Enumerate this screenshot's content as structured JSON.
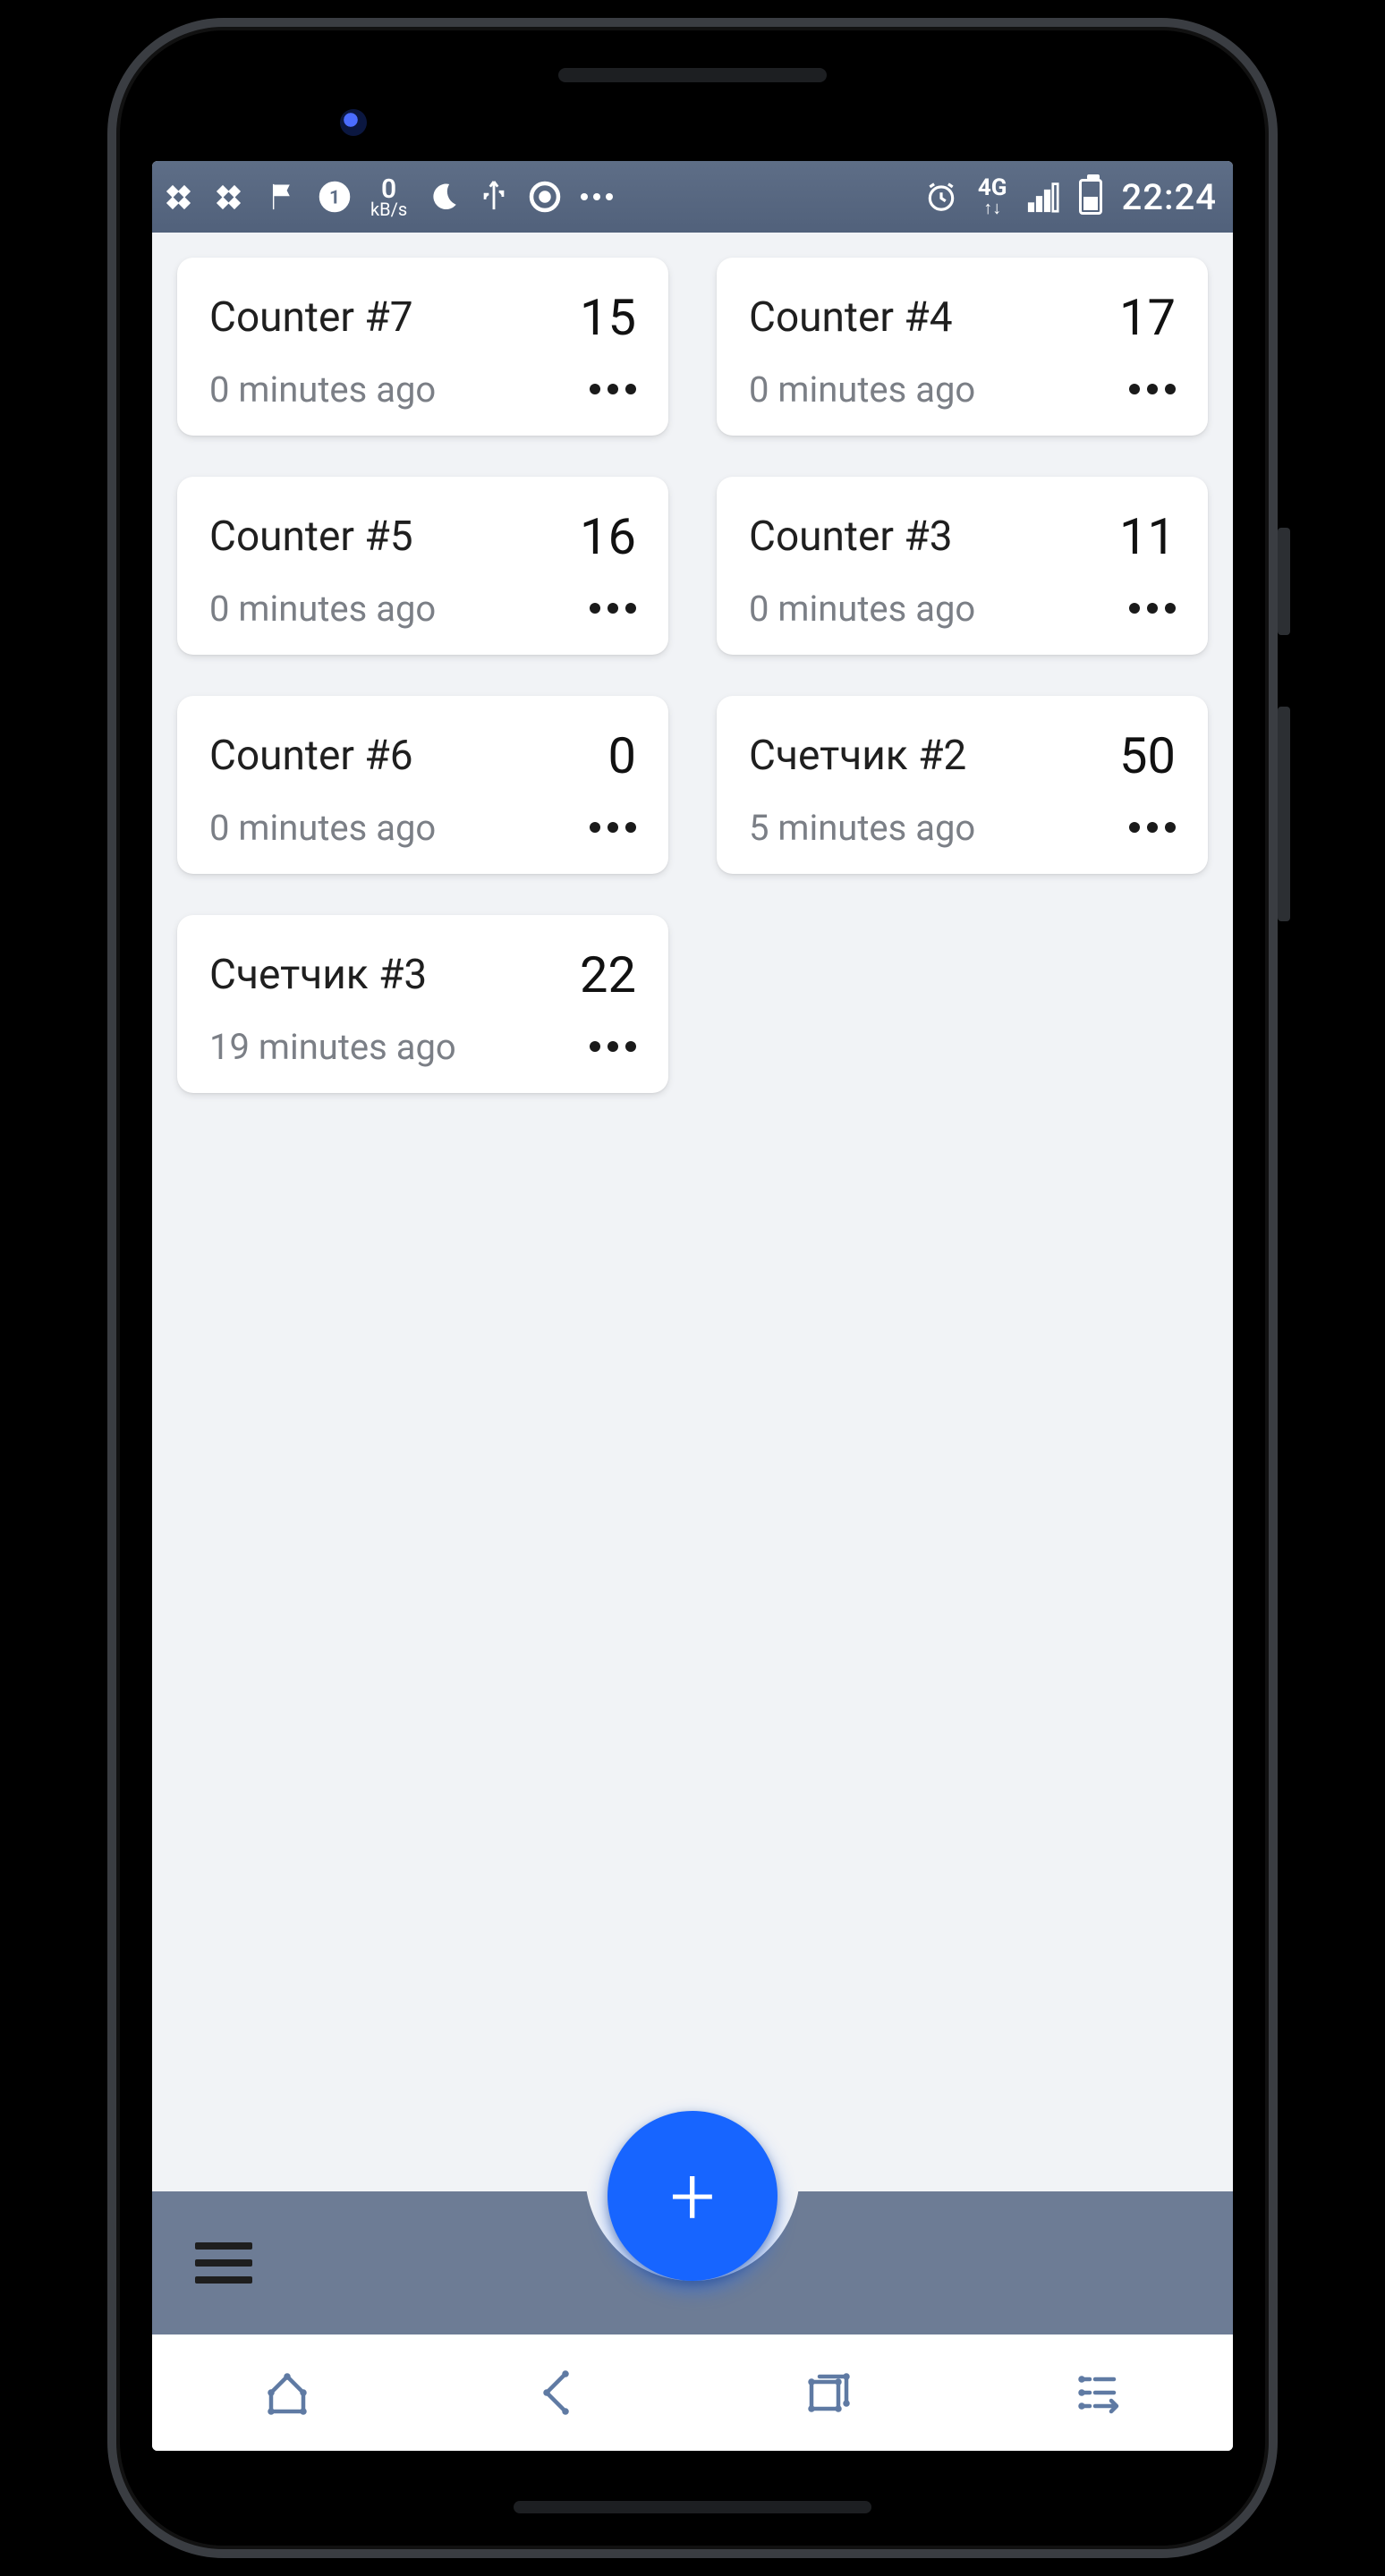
{
  "statusbar": {
    "net_speed_value": "0",
    "net_speed_unit": "kB/s",
    "network_label": "4G",
    "time": "22:24"
  },
  "counters": [
    {
      "title": "Counter #7",
      "value": "15",
      "subtitle": "0 minutes ago"
    },
    {
      "title": "Counter #4",
      "value": "17",
      "subtitle": "0 minutes ago"
    },
    {
      "title": "Counter #5",
      "value": "16",
      "subtitle": "0 minutes ago"
    },
    {
      "title": "Counter #3",
      "value": "11",
      "subtitle": "0 minutes ago"
    },
    {
      "title": "Counter #6",
      "value": "0",
      "subtitle": "0 minutes ago"
    },
    {
      "title": "Счетчик #2",
      "value": "50",
      "subtitle": "5 minutes ago"
    },
    {
      "title": "Счетчик #3",
      "value": "22",
      "subtitle": "19 minutes ago"
    }
  ],
  "fab": {
    "label": "+"
  }
}
